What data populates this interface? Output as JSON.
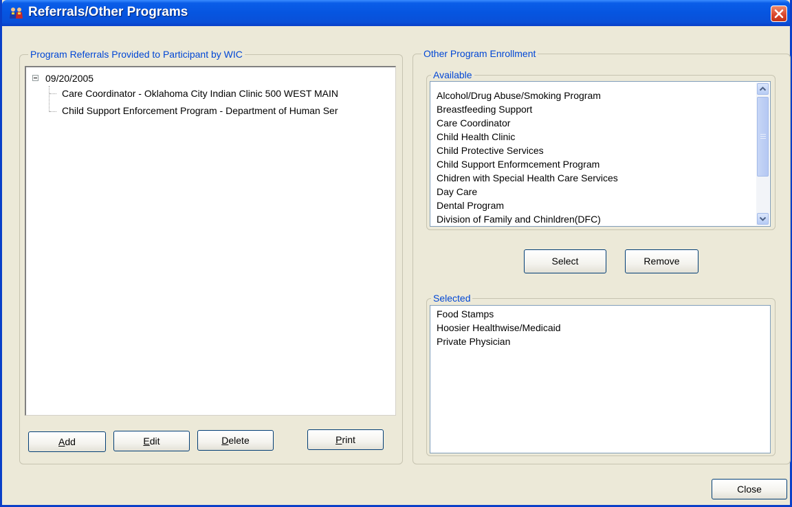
{
  "window": {
    "title": "Referrals/Other Programs",
    "close_label": "Close"
  },
  "colors": {
    "title_bar": "#0655e0",
    "group_legend": "#0046d5",
    "window_bg": "#ece9d8",
    "close_red": "#d9452a"
  },
  "icons": {
    "title": "people-icon",
    "window_close": "close-icon",
    "tree_toggle": "collapse-minus-icon",
    "scroll_up": "chevron-up-icon",
    "scroll_down": "chevron-down-icon"
  },
  "referrals": {
    "group_title": "Program Referrals Provided to Participant by WIC",
    "tree": {
      "date": "09/20/2005",
      "children": [
        "Care Coordinator - Oklahoma City Indian Clinic 500 WEST MAIN",
        "Child Support Enforcement Program - Department of Human Ser"
      ]
    },
    "buttons": {
      "add": {
        "mnemonic": "A",
        "rest": "dd"
      },
      "edit": {
        "mnemonic": "E",
        "rest": "dit"
      },
      "delete": {
        "mnemonic": "D",
        "rest": "elete"
      },
      "print": {
        "mnemonic": "P",
        "rest": "rint"
      }
    }
  },
  "enrollment": {
    "group_title": "Other Program Enrollment",
    "available": {
      "title": "Available",
      "items": [
        "Alcohol/Drug Abuse/Smoking Program",
        "Breastfeeding Support",
        "Care Coordinator",
        "Child Health Clinic",
        "Child Protective Services",
        "Child Support Enformcement Program",
        "Chidren with Special Health Care Services",
        "Day Care",
        "Dental Program",
        "Division of Family and Chinldren(DFC)"
      ]
    },
    "select_label": "Select",
    "remove_label": "Remove",
    "selected": {
      "title": "Selected",
      "items": [
        "Food Stamps",
        "Hoosier Healthwise/Medicaid",
        "Private Physician"
      ]
    }
  }
}
